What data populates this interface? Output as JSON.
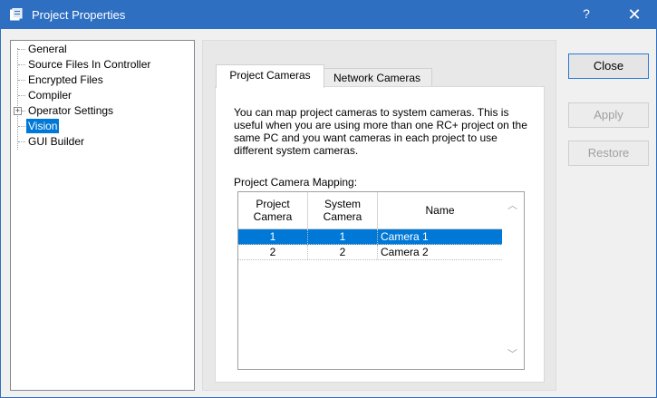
{
  "window": {
    "title": "Project Properties",
    "help_label": "?",
    "close_label": "✕",
    "title_color": "#2f6fc2"
  },
  "tree": {
    "items": [
      {
        "label": "General"
      },
      {
        "label": "Source Files In Controller"
      },
      {
        "label": "Encrypted Files"
      },
      {
        "label": "Compiler"
      },
      {
        "label": "Operator Settings",
        "expander": "+"
      },
      {
        "label": "Vision",
        "selected": true
      },
      {
        "label": "GUI Builder"
      }
    ]
  },
  "tabs": [
    {
      "label": "Project Cameras",
      "active": true
    },
    {
      "label": "Network Cameras",
      "active": false
    }
  ],
  "project_cameras": {
    "description": "You can map project cameras to system cameras. This is useful when you are using more than one RC+ project on the same PC and you want cameras in each project to use different system cameras.",
    "mapping_label": "Project Camera Mapping:",
    "columns": [
      "Project\nCamera",
      "System\nCamera",
      "Name"
    ],
    "rows": [
      {
        "project_camera": "1",
        "system_camera": "1",
        "name": "Camera 1",
        "selected": true
      },
      {
        "project_camera": "2",
        "system_camera": "2",
        "name": "Camera 2",
        "selected": false
      }
    ]
  },
  "buttons": {
    "close": "Close",
    "apply": "Apply",
    "restore": "Restore"
  },
  "colors": {
    "selection": "#0078d7",
    "accent": "#2f6fc2"
  }
}
